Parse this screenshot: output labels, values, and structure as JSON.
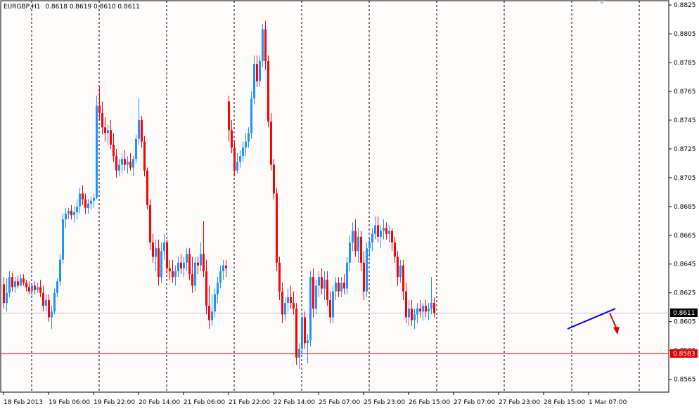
{
  "window": {
    "symbol": "EURGBP,H1",
    "ohlc": "0.8618 0.8619 0.8610 0.8611"
  },
  "colors": {
    "background": "#fefbfb",
    "bull": "#1e90ff",
    "bear": "#ff0000",
    "grid": "#000000",
    "bid_line": "#c0c0c0",
    "level_line": "#e00000",
    "trendline": "#0000ff",
    "arrow": "#e00000"
  },
  "chart_data": {
    "type": "candlestick",
    "symbol": "EURGBP",
    "timeframe": "H1",
    "ylim": [
      0.8556,
      0.8828
    ],
    "y_ticks": [
      "0.8825",
      "0.8805",
      "0.8785",
      "0.8765",
      "0.8745",
      "0.8725",
      "0.8705",
      "0.8685",
      "0.8665",
      "0.8645",
      "0.8625",
      "0.8605",
      "0.8585",
      "0.8565"
    ],
    "x_ticks": [
      {
        "bar": 0,
        "label": "18 Feb 2013"
      },
      {
        "bar": 16,
        "label": "19 Feb 06:00"
      },
      {
        "bar": 32,
        "label": "19 Feb 22:00"
      },
      {
        "bar": 48,
        "label": "20 Feb 14:00"
      },
      {
        "bar": 64,
        "label": "21 Feb 06:00"
      },
      {
        "bar": 80,
        "label": "21 Feb 22:00"
      },
      {
        "bar": 96,
        "label": "22 Feb 14:00"
      },
      {
        "bar": 112,
        "label": "25 Feb 07:00"
      },
      {
        "bar": 128,
        "label": "25 Feb 23:00"
      },
      {
        "bar": 144,
        "label": "26 Feb 15:00"
      },
      {
        "bar": 160,
        "label": "27 Feb 07:00"
      },
      {
        "bar": 176,
        "label": "27 Feb 23:00"
      },
      {
        "bar": 192,
        "label": "28 Feb 15:00"
      },
      {
        "bar": 208,
        "label": "1 Mar 07:00"
      }
    ],
    "separators_bars": [
      10,
      34,
      58,
      82,
      106,
      130,
      154,
      178,
      202,
      226
    ],
    "current_price": {
      "value": 0.8611,
      "label": "0.8611"
    },
    "horizontal_level": {
      "value": 0.8583,
      "label": "0.8583"
    },
    "trendline": {
      "from": {
        "bar": 200.5,
        "price": 0.86
      },
      "to": {
        "bar": 217.5,
        "price": 0.8614
      }
    },
    "arrow": {
      "from": {
        "bar": 215.5,
        "price": 0.8611
      },
      "to": {
        "bar": 218,
        "price": 0.8597
      }
    },
    "candles": [
      [
        0.8631,
        0.8636,
        0.8614,
        0.8618
      ],
      [
        0.8618,
        0.8635,
        0.8612,
        0.8625
      ],
      [
        0.8625,
        0.864,
        0.8622,
        0.8636
      ],
      [
        0.8636,
        0.8639,
        0.8626,
        0.8629
      ],
      [
        0.8629,
        0.8636,
        0.8625,
        0.8633
      ],
      [
        0.8633,
        0.8637,
        0.8628,
        0.863
      ],
      [
        0.863,
        0.8638,
        0.8631,
        0.8635
      ],
      [
        0.8635,
        0.8638,
        0.863,
        0.8632
      ],
      [
        0.8632,
        0.8634,
        0.8626,
        0.8629
      ],
      [
        0.8629,
        0.8633,
        0.8624,
        0.8626
      ],
      [
        0.8626,
        0.8632,
        0.8622,
        0.863
      ],
      [
        0.863,
        0.8633,
        0.8624,
        0.8627
      ],
      [
        0.8627,
        0.8632,
        0.8625,
        0.8629
      ],
      [
        0.8629,
        0.8634,
        0.8622,
        0.8625
      ],
      [
        0.8625,
        0.863,
        0.8612,
        0.8616
      ],
      [
        0.8616,
        0.8624,
        0.8612,
        0.862
      ],
      [
        0.862,
        0.8624,
        0.8605,
        0.8608
      ],
      [
        0.8608,
        0.8616,
        0.86,
        0.8612
      ],
      [
        0.8612,
        0.8628,
        0.861,
        0.8625
      ],
      [
        0.8625,
        0.8635,
        0.8622,
        0.8633
      ],
      [
        0.8633,
        0.8652,
        0.863,
        0.8648
      ],
      [
        0.8648,
        0.868,
        0.8645,
        0.8676
      ],
      [
        0.8676,
        0.8684,
        0.867,
        0.868
      ],
      [
        0.868,
        0.8684,
        0.8676,
        0.8682
      ],
      [
        0.8682,
        0.8686,
        0.8676,
        0.8679
      ],
      [
        0.8679,
        0.8685,
        0.8674,
        0.8681
      ],
      [
        0.8681,
        0.869,
        0.8676,
        0.8685
      ],
      [
        0.8685,
        0.8698,
        0.868,
        0.8694
      ],
      [
        0.8694,
        0.87,
        0.8686,
        0.869
      ],
      [
        0.869,
        0.8694,
        0.868,
        0.8684
      ],
      [
        0.8684,
        0.869,
        0.868,
        0.8687
      ],
      [
        0.8687,
        0.8692,
        0.8683,
        0.8689
      ],
      [
        0.8689,
        0.8694,
        0.8684,
        0.8691
      ],
      [
        0.8691,
        0.8762,
        0.869,
        0.8755
      ],
      [
        0.8755,
        0.8768,
        0.8745,
        0.875
      ],
      [
        0.875,
        0.8758,
        0.8735,
        0.874
      ],
      [
        0.874,
        0.8747,
        0.873,
        0.8736
      ],
      [
        0.8736,
        0.8742,
        0.8728,
        0.8738
      ],
      [
        0.8738,
        0.8745,
        0.8725,
        0.8728
      ],
      [
        0.8728,
        0.8736,
        0.8716,
        0.872
      ],
      [
        0.872,
        0.8725,
        0.8705,
        0.871
      ],
      [
        0.871,
        0.8718,
        0.8706,
        0.8714
      ],
      [
        0.8714,
        0.8722,
        0.8708,
        0.8718
      ],
      [
        0.8718,
        0.8724,
        0.871,
        0.8714
      ],
      [
        0.8714,
        0.872,
        0.8708,
        0.8716
      ],
      [
        0.8716,
        0.8722,
        0.871,
        0.8712
      ],
      [
        0.8712,
        0.872,
        0.8706,
        0.8718
      ],
      [
        0.8718,
        0.8735,
        0.8715,
        0.8732
      ],
      [
        0.8732,
        0.876,
        0.8728,
        0.8745
      ],
      [
        0.8745,
        0.8748,
        0.8726,
        0.873
      ],
      [
        0.873,
        0.8734,
        0.8706,
        0.871
      ],
      [
        0.871,
        0.8712,
        0.8683,
        0.8686
      ],
      [
        0.8686,
        0.869,
        0.8655,
        0.866
      ],
      [
        0.866,
        0.8666,
        0.8646,
        0.865
      ],
      [
        0.865,
        0.8662,
        0.864,
        0.8656
      ],
      [
        0.8656,
        0.8662,
        0.863,
        0.8636
      ],
      [
        0.8636,
        0.866,
        0.8632,
        0.8654
      ],
      [
        0.8654,
        0.8666,
        0.8648,
        0.866
      ],
      [
        0.866,
        0.8662,
        0.8638,
        0.8642
      ],
      [
        0.8642,
        0.8648,
        0.8634,
        0.864
      ],
      [
        0.864,
        0.8648,
        0.8632,
        0.8636
      ],
      [
        0.8636,
        0.8644,
        0.863,
        0.864
      ],
      [
        0.864,
        0.865,
        0.8636,
        0.8646
      ],
      [
        0.8646,
        0.8652,
        0.8638,
        0.8642
      ],
      [
        0.8642,
        0.865,
        0.8636,
        0.8646
      ],
      [
        0.8646,
        0.8656,
        0.864,
        0.8652
      ],
      [
        0.8652,
        0.8656,
        0.8634,
        0.8638
      ],
      [
        0.8638,
        0.865,
        0.8625,
        0.863
      ],
      [
        0.863,
        0.865,
        0.8626,
        0.8646
      ],
      [
        0.8646,
        0.865,
        0.8638,
        0.8644
      ],
      [
        0.8644,
        0.866,
        0.864,
        0.8652
      ],
      [
        0.8652,
        0.8675,
        0.8636,
        0.864
      ],
      [
        0.864,
        0.8648,
        0.861,
        0.8616
      ],
      [
        0.8616,
        0.863,
        0.86,
        0.8606
      ],
      [
        0.8606,
        0.8624,
        0.8602,
        0.8612
      ],
      [
        0.8612,
        0.8628,
        0.8608,
        0.8624
      ],
      [
        0.8624,
        0.8636,
        0.8618,
        0.8632
      ],
      [
        0.8632,
        0.8644,
        0.8628,
        0.864
      ],
      [
        0.864,
        0.8648,
        0.8634,
        0.8644
      ],
      [
        0.8644,
        0.8648,
        0.8636,
        0.8642
      ],
      [
        0.8758,
        0.8762,
        0.873,
        0.8738
      ],
      [
        0.8738,
        0.8745,
        0.8722,
        0.8726
      ],
      [
        0.8726,
        0.873,
        0.8706,
        0.871
      ],
      [
        0.871,
        0.8722,
        0.8708,
        0.8716
      ],
      [
        0.8716,
        0.8724,
        0.8712,
        0.872
      ],
      [
        0.872,
        0.873,
        0.8716,
        0.8726
      ],
      [
        0.8726,
        0.8736,
        0.872,
        0.873
      ],
      [
        0.873,
        0.874,
        0.8726,
        0.8736
      ],
      [
        0.8736,
        0.8765,
        0.8732,
        0.876
      ],
      [
        0.876,
        0.879,
        0.8756,
        0.8784
      ],
      [
        0.8784,
        0.879,
        0.8768,
        0.8772
      ],
      [
        0.8772,
        0.879,
        0.8768,
        0.8786
      ],
      [
        0.8786,
        0.8812,
        0.8782,
        0.8808
      ],
      [
        0.8808,
        0.8814,
        0.878,
        0.8786
      ],
      [
        0.8786,
        0.879,
        0.874,
        0.8744
      ],
      [
        0.8744,
        0.875,
        0.871,
        0.8714
      ],
      [
        0.8714,
        0.8718,
        0.869,
        0.8694
      ],
      [
        0.8694,
        0.8698,
        0.864,
        0.8646
      ],
      [
        0.8646,
        0.865,
        0.862,
        0.8626
      ],
      [
        0.8626,
        0.8632,
        0.8604,
        0.861
      ],
      [
        0.861,
        0.8622,
        0.8606,
        0.8618
      ],
      [
        0.8618,
        0.8628,
        0.8612,
        0.8622
      ],
      [
        0.8622,
        0.863,
        0.8614,
        0.8618
      ],
      [
        0.8618,
        0.8626,
        0.861,
        0.8614
      ],
      [
        0.8614,
        0.8618,
        0.8575,
        0.858
      ],
      [
        0.858,
        0.859,
        0.8572,
        0.8586
      ],
      [
        0.8586,
        0.8612,
        0.8582,
        0.8608
      ],
      [
        0.8608,
        0.8612,
        0.8586,
        0.859
      ],
      [
        0.859,
        0.8596,
        0.8576,
        0.8592
      ],
      [
        0.8592,
        0.864,
        0.8588,
        0.8636
      ],
      [
        0.8636,
        0.8642,
        0.8608,
        0.8614
      ],
      [
        0.8614,
        0.8634,
        0.861,
        0.863
      ],
      [
        0.863,
        0.864,
        0.8622,
        0.8636
      ],
      [
        0.8636,
        0.8642,
        0.8624,
        0.8628
      ],
      [
        0.8628,
        0.864,
        0.862,
        0.8634
      ],
      [
        0.8634,
        0.864,
        0.8616,
        0.862
      ],
      [
        0.862,
        0.8626,
        0.8604,
        0.8608
      ],
      [
        0.8608,
        0.863,
        0.8604,
        0.8626
      ],
      [
        0.8626,
        0.8636,
        0.862,
        0.8632
      ],
      [
        0.8632,
        0.8636,
        0.8622,
        0.8626
      ],
      [
        0.8626,
        0.8636,
        0.8622,
        0.8632
      ],
      [
        0.8632,
        0.8638,
        0.8624,
        0.8628
      ],
      [
        0.8628,
        0.865,
        0.8624,
        0.8646
      ],
      [
        0.8646,
        0.8665,
        0.864,
        0.866
      ],
      [
        0.866,
        0.8674,
        0.8654,
        0.8668
      ],
      [
        0.8668,
        0.8676,
        0.865,
        0.8654
      ],
      [
        0.8654,
        0.867,
        0.8646,
        0.8664
      ],
      [
        0.8664,
        0.8668,
        0.864,
        0.8646
      ],
      [
        0.8646,
        0.8654,
        0.862,
        0.8626
      ],
      [
        0.8626,
        0.866,
        0.8622,
        0.8656
      ],
      [
        0.8656,
        0.8664,
        0.865,
        0.866
      ],
      [
        0.866,
        0.867,
        0.8654,
        0.8666
      ],
      [
        0.8666,
        0.8678,
        0.8662,
        0.8672
      ],
      [
        0.8672,
        0.8678,
        0.866,
        0.8664
      ],
      [
        0.8664,
        0.8672,
        0.8656,
        0.8668
      ],
      [
        0.8668,
        0.8676,
        0.8662,
        0.867
      ],
      [
        0.867,
        0.8674,
        0.8662,
        0.8666
      ],
      [
        0.8666,
        0.8672,
        0.866,
        0.8668
      ],
      [
        0.8668,
        0.867,
        0.8654,
        0.866
      ],
      [
        0.866,
        0.8664,
        0.8646,
        0.865
      ],
      [
        0.865,
        0.8654,
        0.863,
        0.8636
      ],
      [
        0.8636,
        0.8648,
        0.8632,
        0.8644
      ],
      [
        0.8644,
        0.8648,
        0.862,
        0.8626
      ],
      [
        0.8626,
        0.8632,
        0.8604,
        0.8608
      ],
      [
        0.8608,
        0.862,
        0.8602,
        0.8614
      ],
      [
        0.8614,
        0.862,
        0.8602,
        0.8606
      ],
      [
        0.8606,
        0.8614,
        0.86,
        0.861
      ],
      [
        0.861,
        0.8618,
        0.8604,
        0.8614
      ],
      [
        0.8614,
        0.862,
        0.8608,
        0.8612
      ],
      [
        0.8612,
        0.8618,
        0.8606,
        0.8616
      ],
      [
        0.8616,
        0.862,
        0.8608,
        0.8612
      ],
      [
        0.8612,
        0.8618,
        0.8606,
        0.8614
      ],
      [
        0.8614,
        0.8636,
        0.861,
        0.8618
      ],
      [
        0.8618,
        0.8622,
        0.8608,
        0.8611
      ]
    ]
  }
}
